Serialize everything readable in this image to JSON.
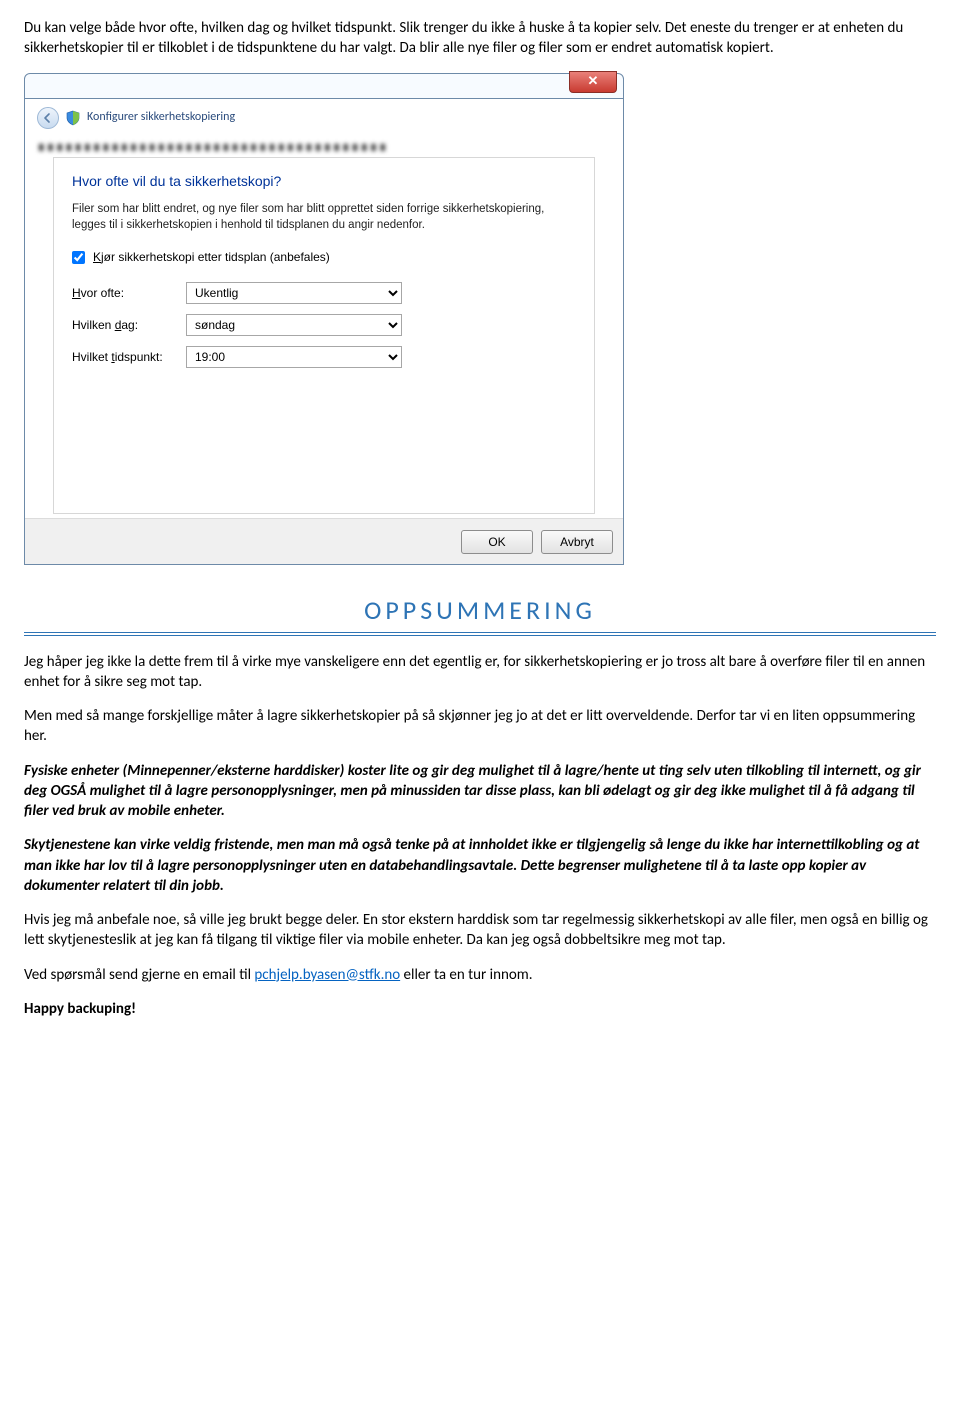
{
  "intro": {
    "p1": "Du kan velge både hvor ofte, hvilken dag og hvilket tidspunkt. Slik trenger du ikke å huske å ta kopier selv. Det eneste du trenger er at enheten du sikkerhetskopier til er tilkoblet i de tidspunktene du har valgt. Da blir alle nye filer og filer som er endret automatisk kopiert."
  },
  "dialog": {
    "crumb": "Konfigurer sikkerhetskopiering",
    "close_x": "✕",
    "blurred": "▖▖▖▖▖▖▖▖▖▖▖▖▖▖▖▖▖▖▖▖▖▖▖▖▖▖▖▖▖▖▖▖▖▖▖▖▖▖",
    "question": "Hvor ofte vil du ta sikkerhetskopi?",
    "desc": "Filer som har blitt endret, og nye filer som har blitt opprettet siden forrige sikkerhetskopiering, legges til i sikkerhetskopien i henhold til tidsplanen du angir nedenfor.",
    "checkbox_prefix_under": "K",
    "checkbox_rest": "jør sikkerhetskopi etter tidsplan (anbefales)",
    "row_ofte": {
      "label_under": "H",
      "label_rest": "vor ofte:",
      "value": "Ukentlig"
    },
    "row_dag": {
      "label_under": "d",
      "label_pre": "Hvilken ",
      "label_rest": "ag:",
      "value": "søndag"
    },
    "row_tid": {
      "label_under": "t",
      "label_pre": "Hvilket ",
      "label_rest": "idspunkt:",
      "value": "19:00"
    },
    "ok": "OK",
    "cancel": "Avbryt"
  },
  "summary": {
    "title": "OPPSUMMERING",
    "p1": "Jeg håper jeg ikke la dette frem til å virke mye vanskeligere enn det egentlig er, for sikkerhetskopiering er jo tross alt bare å overføre filer til en annen enhet for å sikre seg mot tap.",
    "p2": "Men med så mange forskjellige måter å lagre sikkerhetskopier på så skjønner jeg jo at det er litt overveldende. Derfor tar vi en liten oppsummering her.",
    "p3": " Fysiske enheter (Minnepenner/eksterne harddisker) koster lite og gir deg mulighet til å lagre/hente ut ting selv uten tilkobling til internett, og gir deg OGSÅ mulighet til å lagre personopplysninger, men på minussiden tar disse plass, kan bli ødelagt og gir deg ikke mulighet til å få adgang til filer ved bruk av mobile enheter.",
    "p4": "Skytjenestene kan virke veldig fristende, men man må også tenke på at innholdet ikke er tilgjengelig så lenge du ikke har internettilkobling og at man ikke har lov til å lagre personopplysninger uten en databehandlingsavtale. Dette begrenser mulighetene til å ta laste opp kopier av dokumenter relatert til din jobb.",
    "p5": "Hvis jeg må anbefale noe, så ville jeg brukt begge deler. En stor ekstern harddisk som tar regelmessig sikkerhetskopi av alle filer, men også en billig og lett skytjenesteslik at jeg kan få tilgang til viktige filer via mobile enheter. Da kan jeg også dobbeltsikre meg mot tap.",
    "p6_pre": "Ved spørsmål send gjerne en email til ",
    "email": "pchjelp.byasen@stfk.no",
    "p6_post": " eller ta en tur innom.",
    "happy": "Happy backuping!"
  }
}
